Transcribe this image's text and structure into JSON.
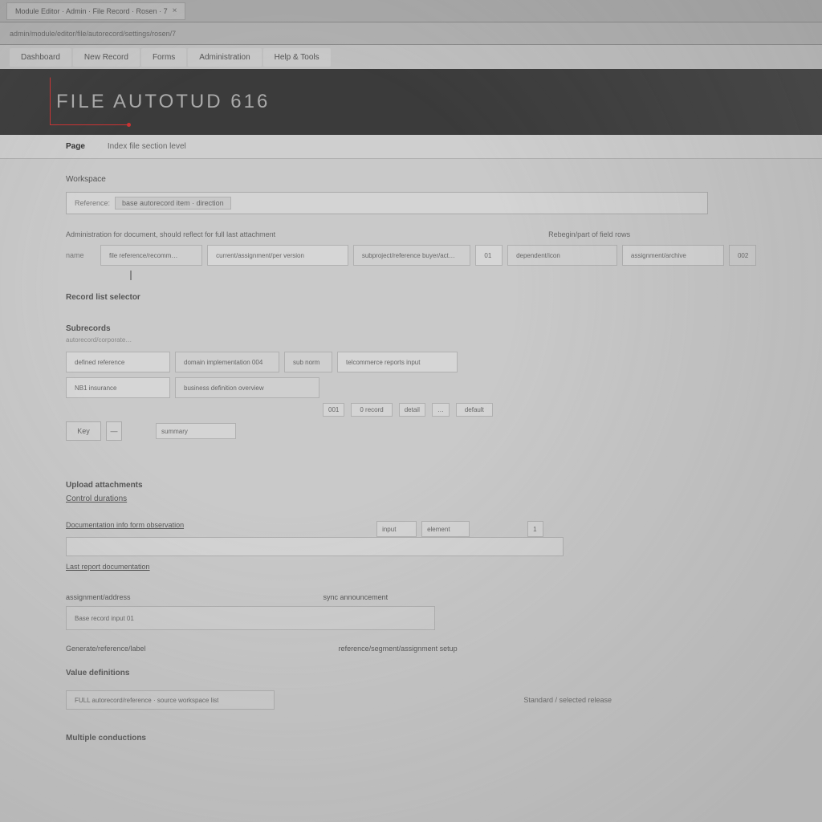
{
  "browser": {
    "tab_title": "Module Editor · Admin · File Record · Rosen · 7",
    "tab_close": "×",
    "url": "admin/module/editor/file/autorecord/settings/rosen/7"
  },
  "topnav": {
    "items": [
      "Dashboard",
      "New Record",
      "Forms",
      "Administration",
      "Help & Tools"
    ]
  },
  "hero": {
    "title": "FILE AUTOTUD 616"
  },
  "subnav": {
    "active": "Page",
    "details": "Index file section level"
  },
  "sections": {
    "s1_label": "Workspace",
    "s1_field_prefix": "Reference:",
    "s1_field_value": "base autorecord item · direction",
    "row_label_left": "Administration for document, should reflect for full last attachment",
    "row_label_right": "Rebegin/part of field rows",
    "row1_label": "name",
    "row1_c1": "file reference/recomm…",
    "row1_c2": "current/assignment/per version",
    "row1_c3": "subproject/reference buyer/act…",
    "row1_c4": "01",
    "row1_c5": "dependent/icon",
    "row1_c6": "assignment/archive",
    "row1_c7": "002",
    "s2_label": "Record list selector",
    "s3_label": "Subrecords",
    "s3_sub": "autorecord/corporate…",
    "r2_c1": "defined reference",
    "r2_c2": "domain implementation 004",
    "r2_c3": "sub norm",
    "r2_c4": "telcommerce reports input",
    "r3_c1": "NB1 insurance",
    "r3_c2": "business definition overview",
    "pills": {
      "a": "001",
      "b": "0 record",
      "c": "detail",
      "d": "…",
      "e": "default"
    },
    "key_row_label": "Key",
    "key_row_val": "—",
    "key_chip": "summary",
    "s4_label": "Upload attachments",
    "s4_sub": "Control durations",
    "form_label_a": "Documentation info form observation",
    "form_val_a": "",
    "form_pill_a": "input",
    "form_pill_b": "element",
    "form_side": "1",
    "form_label_b": "Last report documentation",
    "form_label_c": "assignment/address",
    "form_label_right": "sync announcement",
    "form_box_c": "Base record input 01",
    "form_row_d_left": "Generate/reference/label",
    "form_row_d_right": "reference/segment/assignment setup",
    "s5_label": "Value definitions",
    "s5_val": "FULL autorecord/reference · source workspace list",
    "right_banner": "Standard / selected release",
    "s6_label": "Multiple conductions"
  }
}
